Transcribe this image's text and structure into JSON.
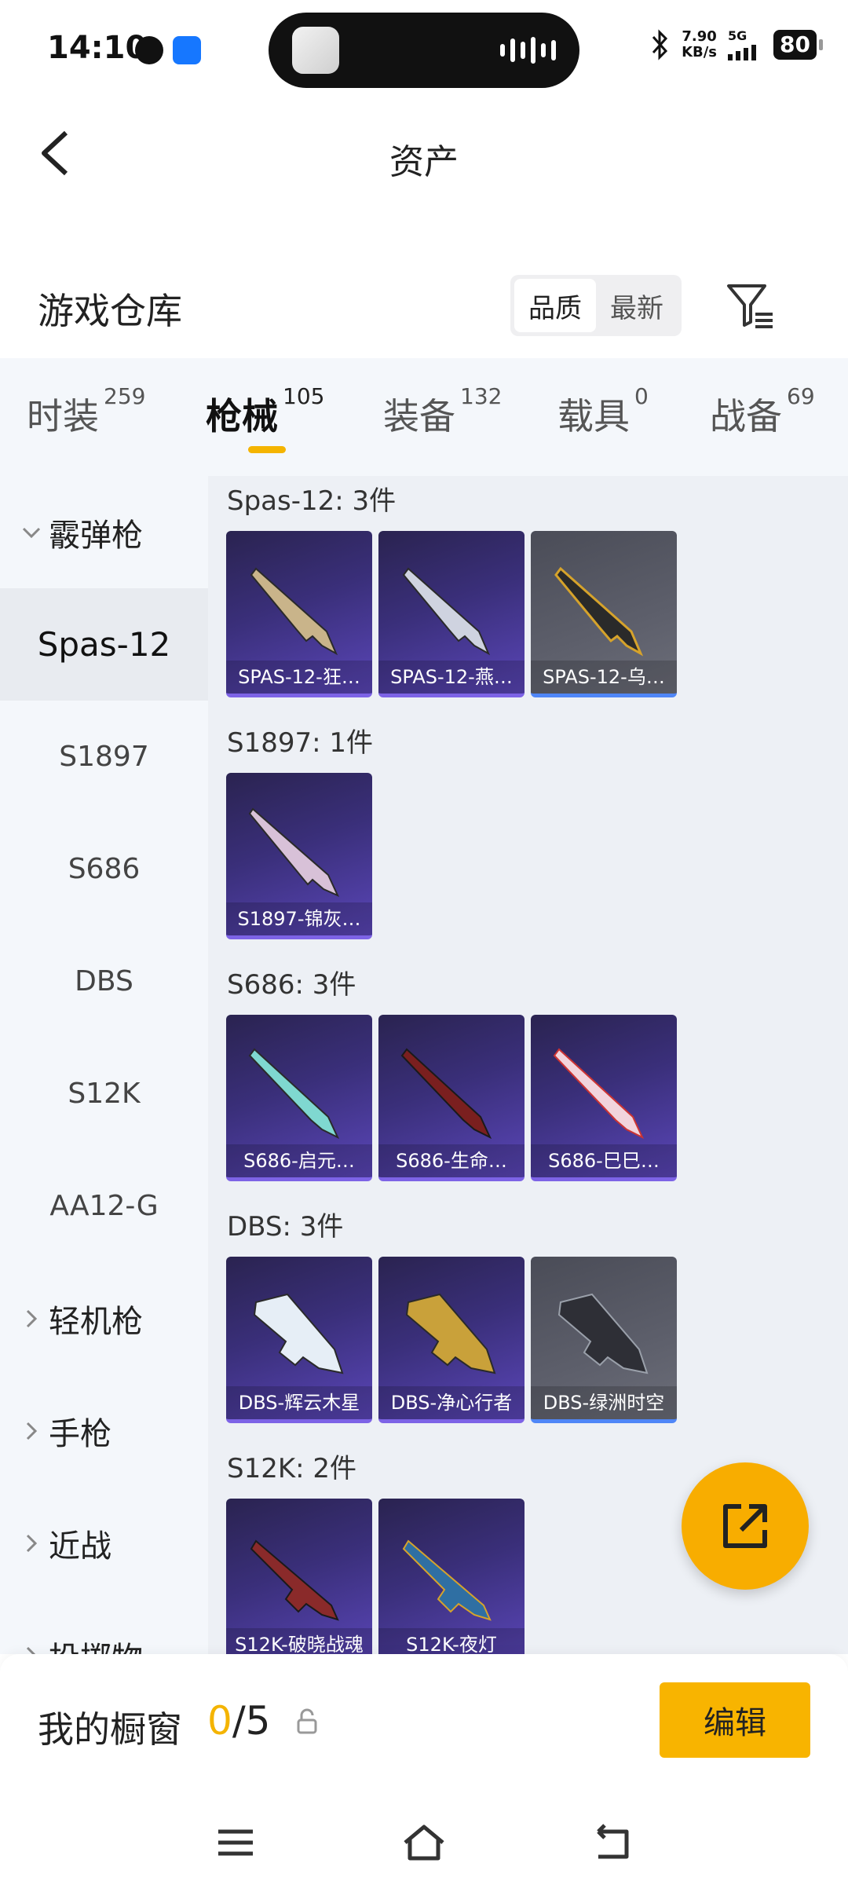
{
  "status_bar": {
    "time": "14:10",
    "net_speed_value": "7.90",
    "net_speed_unit": "KB/s",
    "network_type": "5G",
    "battery": "80"
  },
  "header": {
    "title": "资产"
  },
  "warehouse": {
    "title": "游戏仓库",
    "sort_options": [
      "品质",
      "最新"
    ],
    "active_sort": "品质"
  },
  "tabs": [
    {
      "label": "时装",
      "count": "259"
    },
    {
      "label": "枪械",
      "count": "105"
    },
    {
      "label": "装备",
      "count": "132"
    },
    {
      "label": "载具",
      "count": "0"
    },
    {
      "label": "战备",
      "count": "69"
    }
  ],
  "active_tab": "枪械",
  "sidebar": {
    "category_open": "霰弹枪",
    "items": [
      "Spas-12",
      "S1897",
      "S686",
      "DBS",
      "S12K",
      "AA12-G"
    ],
    "selected": "Spas-12",
    "categories_closed": [
      "轻机枪",
      "手枪",
      "近战",
      "投掷物"
    ]
  },
  "groups": [
    {
      "title": "Spas-12: 3件",
      "items": [
        "SPAS-12-狂…",
        "SPAS-12-燕…",
        "SPAS-12-乌…"
      ]
    },
    {
      "title": "S1897: 1件",
      "items": [
        "S1897-锦灰…"
      ]
    },
    {
      "title": "S686: 3件",
      "items": [
        "S686-启元…",
        "S686-生命…",
        "S686-巳巳…"
      ]
    },
    {
      "title": "DBS: 3件",
      "items": [
        "DBS-辉云木星",
        "DBS-净心行者",
        "DBS-绿洲时空"
      ]
    },
    {
      "title": "S12K: 2件",
      "items": [
        "S12K-破晓战魂",
        "S12K-夜灯"
      ]
    }
  ],
  "bottom": {
    "showcase_label": "我的橱窗",
    "showcase_current": "0",
    "showcase_total": "/5",
    "edit_label": "编辑"
  },
  "colors": {
    "accent": "#f8b400",
    "card_purple": "#3a2f7a",
    "card_grey": "#5d5f6b"
  }
}
